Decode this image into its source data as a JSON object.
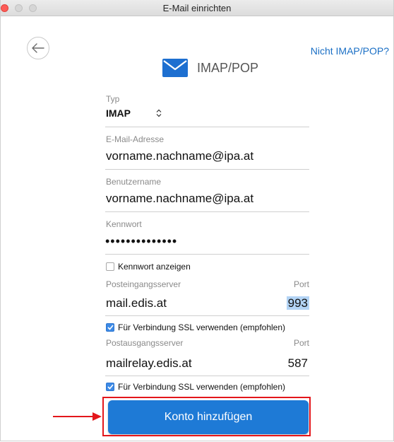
{
  "window": {
    "title": "E-Mail einrichten"
  },
  "header": {
    "link_not_imap": "Nicht IMAP/POP?",
    "title": "IMAP/POP"
  },
  "form": {
    "type_label": "Typ",
    "type_value": "IMAP",
    "email_label": "E-Mail-Adresse",
    "email_value": "vorname.nachname@ipa.at",
    "username_label": "Benutzername",
    "username_value": "vorname.nachname@ipa.at",
    "password_label": "Kennwort",
    "password_value": "••••••••••••••",
    "show_password_label": "Kennwort anzeigen",
    "incoming_label": "Posteingangsserver",
    "incoming_value": "mail.edis.at",
    "incoming_port_label": "Port",
    "incoming_port_value": "993",
    "incoming_ssl_label": "Für Verbindung SSL verwenden (empfohlen)",
    "outgoing_label": "Postausgangsserver",
    "outgoing_value": "mailrelay.edis.at",
    "outgoing_port_label": "Port",
    "outgoing_port_value": "587",
    "outgoing_ssl_label": "Für Verbindung SSL verwenden (empfohlen)"
  },
  "actions": {
    "add_account_label": "Konto hinzufügen"
  },
  "colors": {
    "accent": "#1e7ad6",
    "link": "#1a6fc5",
    "annotation": "#e3161b"
  },
  "icons": {
    "back": "arrow-left-icon",
    "mail": "envelope-icon",
    "select": "chevron-updown-icon",
    "check": "checkmark-icon"
  }
}
